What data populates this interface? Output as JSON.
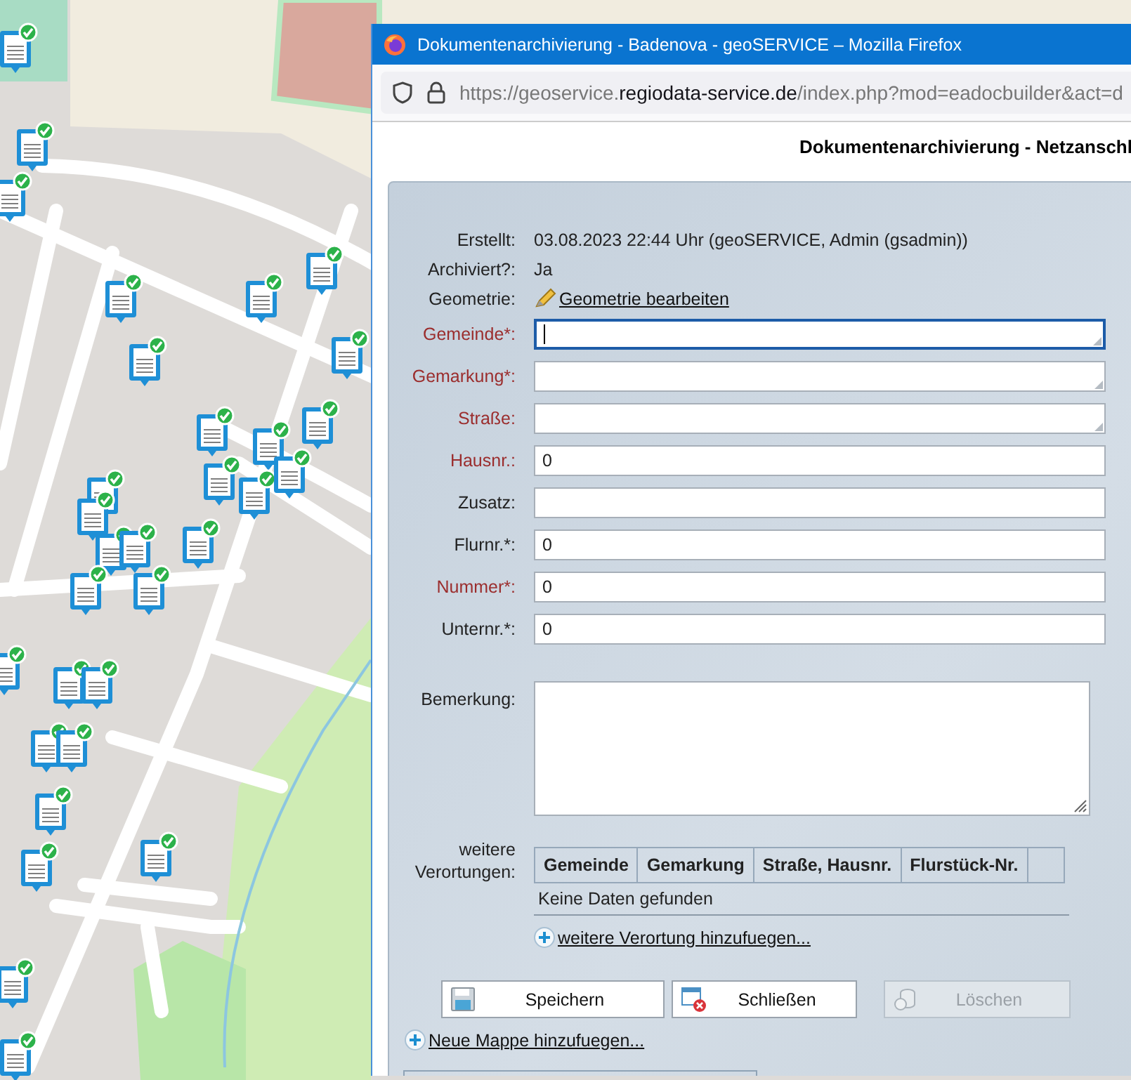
{
  "window": {
    "title": "Dokumentenarchivierung - Badenova - geoSERVICE – Mozilla Firefox"
  },
  "address_bar": {
    "prefix": "https://geoservice.",
    "domain": "regiodata-service.de",
    "path": "/index.php?mod=eadocbuilder&act=d"
  },
  "page": {
    "heading": "Dokumentenarchivierung - Netzanschl"
  },
  "info": [
    {
      "label": "Erstellt:",
      "value": "03.08.2023 22:44 Uhr (geoSERVICE, Admin (gsadmin))",
      "kind": "text"
    },
    {
      "label": "Archiviert?:",
      "value": "Ja",
      "kind": "text"
    },
    {
      "label": "Geometrie:",
      "value": "Geometrie bearbeiten",
      "kind": "link"
    }
  ],
  "fields": [
    {
      "label": "Gemeinde*:",
      "required": true,
      "kind": "textarea",
      "focused": true
    },
    {
      "label": "Gemarkung*:",
      "required": true,
      "kind": "textarea",
      "focused": false
    },
    {
      "label": "Straße:",
      "required": true,
      "kind": "textarea",
      "focused": false
    },
    {
      "label": "Hausnr.:",
      "required": true,
      "kind": "text",
      "focused": false,
      "value": "0"
    },
    {
      "label": "Zusatz:",
      "required": false,
      "kind": "text",
      "focused": false
    },
    {
      "label": "Flurnr.*:",
      "required": false,
      "kind": "text",
      "focused": false,
      "value": "0"
    },
    {
      "label": "Nummer*:",
      "required": true,
      "kind": "text",
      "focused": false,
      "value": "0"
    },
    {
      "label": "Unternr.*:",
      "required": false,
      "kind": "text",
      "focused": false,
      "value": "0"
    }
  ],
  "remark": {
    "label": "Bemerkung:"
  },
  "locations": {
    "label": "weitere Verortungen:",
    "columns": [
      "Gemeinde",
      "Gemarkung",
      "Straße, Hausnr.",
      "Flurstück-Nr."
    ],
    "empty_message": "Keine Daten gefunden",
    "add_link": "weitere Verortung hinzufuegen..."
  },
  "buttons": [
    {
      "label": "Speichern",
      "kind": "save",
      "disabled": false
    },
    {
      "label": "Schließen",
      "kind": "close",
      "disabled": false
    },
    {
      "label": "Löschen",
      "kind": "delete",
      "disabled": true
    }
  ],
  "new_folder_link": "Neue Mappe hinzufuegen..."
}
